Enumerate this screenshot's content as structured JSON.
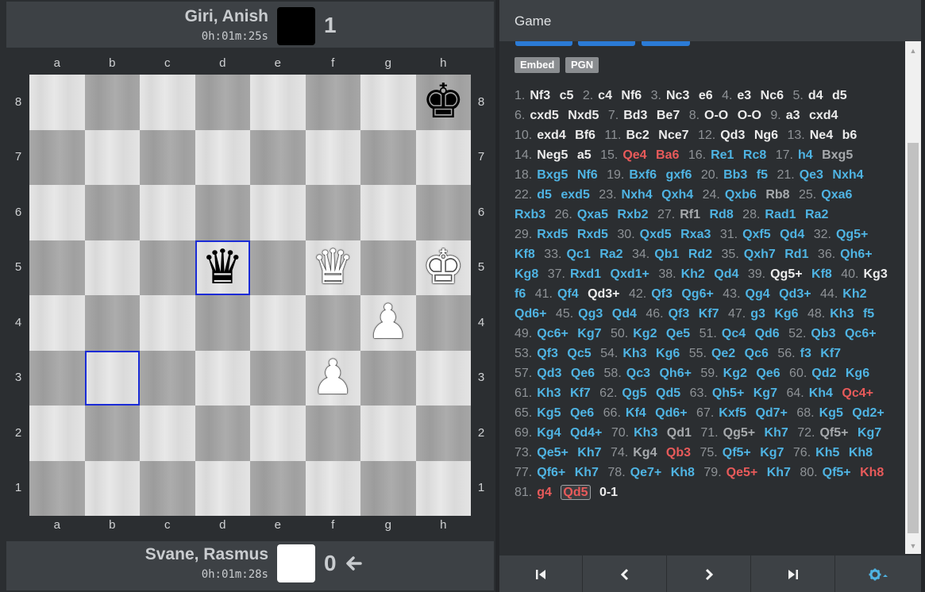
{
  "top_player": {
    "name": "Giri, Anish",
    "clock": "0h:01m:25s",
    "score": "1",
    "color": "black"
  },
  "bottom_player": {
    "name": "Svane, Rasmus",
    "clock": "0h:01m:28s",
    "score": "0",
    "color": "white",
    "to_move_icon": "arrow-left-icon"
  },
  "board": {
    "files": [
      "a",
      "b",
      "c",
      "d",
      "e",
      "f",
      "g",
      "h"
    ],
    "ranks": [
      "8",
      "7",
      "6",
      "5",
      "4",
      "3",
      "2",
      "1"
    ],
    "pieces": [
      {
        "square": "h8",
        "piece": "king",
        "color": "black"
      },
      {
        "square": "d5",
        "piece": "queen",
        "color": "black"
      },
      {
        "square": "f5",
        "piece": "queen",
        "color": "white"
      },
      {
        "square": "h5",
        "piece": "king",
        "color": "white"
      },
      {
        "square": "g4",
        "piece": "pawn",
        "color": "white"
      },
      {
        "square": "f3",
        "piece": "pawn",
        "color": "white"
      }
    ],
    "highlight_squares": [
      "d5",
      "b3"
    ],
    "highlight_color": "#1a2bd6"
  },
  "game_panel": {
    "title": "Game",
    "embed_label": "Embed",
    "pgn_label": "PGN",
    "moves": [
      {
        "n": "1.",
        "w": "Nf3",
        "wc": "white",
        "b": "c5",
        "bc": "white"
      },
      {
        "n": "2.",
        "w": "c4",
        "wc": "white",
        "b": "Nf6",
        "bc": "white"
      },
      {
        "n": "3.",
        "w": "Nc3",
        "wc": "white",
        "b": "e6",
        "bc": "white"
      },
      {
        "n": "4.",
        "w": "e3",
        "wc": "white",
        "b": "Nc6",
        "bc": "white"
      },
      {
        "n": "5.",
        "w": "d4",
        "wc": "white",
        "b": "d5",
        "bc": "white"
      },
      {
        "n": "6.",
        "w": "cxd5",
        "wc": "white",
        "b": "Nxd5",
        "bc": "white"
      },
      {
        "n": "7.",
        "w": "Bd3",
        "wc": "white",
        "b": "Be7",
        "bc": "white"
      },
      {
        "n": "8.",
        "w": "O-O",
        "wc": "white",
        "b": "O-O",
        "bc": "white"
      },
      {
        "n": "9.",
        "w": "a3",
        "wc": "white",
        "b": "cxd4",
        "bc": "white"
      },
      {
        "n": "10.",
        "w": "exd4",
        "wc": "white",
        "b": "Bf6",
        "bc": "white"
      },
      {
        "n": "11.",
        "w": "Bc2",
        "wc": "white",
        "b": "Nce7",
        "bc": "white"
      },
      {
        "n": "12.",
        "w": "Qd3",
        "wc": "white",
        "b": "Ng6",
        "bc": "white"
      },
      {
        "n": "13.",
        "w": "Ne4",
        "wc": "white",
        "b": "b6",
        "bc": "white"
      },
      {
        "n": "14.",
        "w": "Neg5",
        "wc": "white",
        "b": "a5",
        "bc": "white"
      },
      {
        "n": "15.",
        "w": "Qe4",
        "wc": "red",
        "b": "Ba6",
        "bc": "red"
      },
      {
        "n": "16.",
        "w": "Re1",
        "wc": "blue",
        "b": "Rc8",
        "bc": "blue"
      },
      {
        "n": "17.",
        "w": "h4",
        "wc": "blue",
        "b": "Bxg5",
        "bc": "grey"
      },
      {
        "n": "18.",
        "w": "Bxg5",
        "wc": "blue",
        "b": "Nf6",
        "bc": "blue"
      },
      {
        "n": "19.",
        "w": "Bxf6",
        "wc": "blue",
        "b": "gxf6",
        "bc": "blue"
      },
      {
        "n": "20.",
        "w": "Bb3",
        "wc": "blue",
        "b": "f5",
        "bc": "blue"
      },
      {
        "n": "21.",
        "w": "Qe3",
        "wc": "blue",
        "b": "Nxh4",
        "bc": "blue"
      },
      {
        "n": "22.",
        "w": "d5",
        "wc": "blue",
        "b": "exd5",
        "bc": "blue"
      },
      {
        "n": "23.",
        "w": "Nxh4",
        "wc": "blue",
        "b": "Qxh4",
        "bc": "blue"
      },
      {
        "n": "24.",
        "w": "Qxb6",
        "wc": "blue",
        "b": "Rb8",
        "bc": "grey"
      },
      {
        "n": "25.",
        "w": "Qxa6",
        "wc": "blue",
        "b": "Rxb3",
        "bc": "blue"
      },
      {
        "n": "26.",
        "w": "Qxa5",
        "wc": "blue",
        "b": "Rxb2",
        "bc": "blue"
      },
      {
        "n": "27.",
        "w": "Rf1",
        "wc": "grey",
        "b": "Rd8",
        "bc": "blue"
      },
      {
        "n": "28.",
        "w": "Rad1",
        "wc": "blue",
        "b": "Ra2",
        "bc": "blue"
      },
      {
        "n": "29.",
        "w": "Rxd5",
        "wc": "blue",
        "b": "Rxd5",
        "bc": "blue"
      },
      {
        "n": "30.",
        "w": "Qxd5",
        "wc": "blue",
        "b": "Rxa3",
        "bc": "blue"
      },
      {
        "n": "31.",
        "w": "Qxf5",
        "wc": "blue",
        "b": "Qd4",
        "bc": "blue"
      },
      {
        "n": "32.",
        "w": "Qg5+",
        "wc": "blue",
        "b": "Kf8",
        "bc": "blue"
      },
      {
        "n": "33.",
        "w": "Qc1",
        "wc": "blue",
        "b": "Ra2",
        "bc": "blue"
      },
      {
        "n": "34.",
        "w": "Qb1",
        "wc": "blue",
        "b": "Rd2",
        "bc": "blue"
      },
      {
        "n": "35.",
        "w": "Qxh7",
        "wc": "blue",
        "b": "Rd1",
        "bc": "blue"
      },
      {
        "n": "36.",
        "w": "Qh6+",
        "wc": "blue",
        "b": "Kg8",
        "bc": "blue"
      },
      {
        "n": "37.",
        "w": "Rxd1",
        "wc": "blue",
        "b": "Qxd1+",
        "bc": "blue"
      },
      {
        "n": "38.",
        "w": "Kh2",
        "wc": "blue",
        "b": "Qd4",
        "bc": "blue"
      },
      {
        "n": "39.",
        "w": "Qg5+",
        "wc": "white",
        "b": "Kf8",
        "bc": "blue"
      },
      {
        "n": "40.",
        "w": "Kg3",
        "wc": "white",
        "b": "f6",
        "bc": "blue"
      },
      {
        "n": "41.",
        "w": "Qf4",
        "wc": "blue",
        "b": "Qd3+",
        "bc": "white"
      },
      {
        "n": "42.",
        "w": "Qf3",
        "wc": "blue",
        "b": "Qg6+",
        "bc": "blue"
      },
      {
        "n": "43.",
        "w": "Qg4",
        "wc": "blue",
        "b": "Qd3+",
        "bc": "blue"
      },
      {
        "n": "44.",
        "w": "Kh2",
        "wc": "blue",
        "b": "Qd6+",
        "bc": "blue"
      },
      {
        "n": "45.",
        "w": "Qg3",
        "wc": "blue",
        "b": "Qd4",
        "bc": "blue"
      },
      {
        "n": "46.",
        "w": "Qf3",
        "wc": "blue",
        "b": "Kf7",
        "bc": "blue"
      },
      {
        "n": "47.",
        "w": "g3",
        "wc": "blue",
        "b": "Kg6",
        "bc": "blue"
      },
      {
        "n": "48.",
        "w": "Kh3",
        "wc": "blue",
        "b": "f5",
        "bc": "blue"
      },
      {
        "n": "49.",
        "w": "Qc6+",
        "wc": "blue",
        "b": "Kg7",
        "bc": "blue"
      },
      {
        "n": "50.",
        "w": "Kg2",
        "wc": "blue",
        "b": "Qe5",
        "bc": "blue"
      },
      {
        "n": "51.",
        "w": "Qc4",
        "wc": "blue",
        "b": "Qd6",
        "bc": "blue"
      },
      {
        "n": "52.",
        "w": "Qb3",
        "wc": "blue",
        "b": "Qc6+",
        "bc": "blue"
      },
      {
        "n": "53.",
        "w": "Qf3",
        "wc": "blue",
        "b": "Qc5",
        "bc": "blue"
      },
      {
        "n": "54.",
        "w": "Kh3",
        "wc": "blue",
        "b": "Kg6",
        "bc": "blue"
      },
      {
        "n": "55.",
        "w": "Qe2",
        "wc": "blue",
        "b": "Qc6",
        "bc": "blue"
      },
      {
        "n": "56.",
        "w": "f3",
        "wc": "blue",
        "b": "Kf7",
        "bc": "blue"
      },
      {
        "n": "57.",
        "w": "Qd3",
        "wc": "blue",
        "b": "Qe6",
        "bc": "blue"
      },
      {
        "n": "58.",
        "w": "Qc3",
        "wc": "blue",
        "b": "Qh6+",
        "bc": "blue"
      },
      {
        "n": "59.",
        "w": "Kg2",
        "wc": "blue",
        "b": "Qe6",
        "bc": "blue"
      },
      {
        "n": "60.",
        "w": "Qd2",
        "wc": "blue",
        "b": "Kg6",
        "bc": "blue"
      },
      {
        "n": "61.",
        "w": "Kh3",
        "wc": "blue",
        "b": "Kf7",
        "bc": "blue"
      },
      {
        "n": "62.",
        "w": "Qg5",
        "wc": "blue",
        "b": "Qd5",
        "bc": "blue"
      },
      {
        "n": "63.",
        "w": "Qh5+",
        "wc": "blue",
        "b": "Kg7",
        "bc": "blue"
      },
      {
        "n": "64.",
        "w": "Kh4",
        "wc": "blue",
        "b": "Qc4+",
        "bc": "red"
      },
      {
        "n": "65.",
        "w": "Kg5",
        "wc": "blue",
        "b": "Qe6",
        "bc": "blue"
      },
      {
        "n": "66.",
        "w": "Kf4",
        "wc": "blue",
        "b": "Qd6+",
        "bc": "blue"
      },
      {
        "n": "67.",
        "w": "Kxf5",
        "wc": "blue",
        "b": "Qd7+",
        "bc": "blue"
      },
      {
        "n": "68.",
        "w": "Kg5",
        "wc": "blue",
        "b": "Qd2+",
        "bc": "blue"
      },
      {
        "n": "69.",
        "w": "Kg4",
        "wc": "blue",
        "b": "Qd4+",
        "bc": "blue"
      },
      {
        "n": "70.",
        "w": "Kh3",
        "wc": "blue",
        "b": "Qd1",
        "bc": "grey"
      },
      {
        "n": "71.",
        "w": "Qg5+",
        "wc": "grey",
        "b": "Kh7",
        "bc": "blue"
      },
      {
        "n": "72.",
        "w": "Qf5+",
        "wc": "grey",
        "b": "Kg7",
        "bc": "blue"
      },
      {
        "n": "73.",
        "w": "Qe5+",
        "wc": "blue",
        "b": "Kh7",
        "bc": "blue"
      },
      {
        "n": "74.",
        "w": "Kg4",
        "wc": "grey",
        "b": "Qb3",
        "bc": "red"
      },
      {
        "n": "75.",
        "w": "Qf5+",
        "wc": "blue",
        "b": "Kg7",
        "bc": "blue"
      },
      {
        "n": "76.",
        "w": "Kh5",
        "wc": "blue",
        "b": "Kh8",
        "bc": "blue"
      },
      {
        "n": "77.",
        "w": "Qf6+",
        "wc": "blue",
        "b": "Kh7",
        "bc": "blue"
      },
      {
        "n": "78.",
        "w": "Qe7+",
        "wc": "blue",
        "b": "Kh8",
        "bc": "blue"
      },
      {
        "n": "79.",
        "w": "Qe5+",
        "wc": "red",
        "b": "Kh7",
        "bc": "blue"
      },
      {
        "n": "80.",
        "w": "Qf5+",
        "wc": "blue",
        "b": "Kh8",
        "bc": "red"
      },
      {
        "n": "81.",
        "w": "g4",
        "wc": "red",
        "b": "Qd5",
        "bc": "current"
      }
    ],
    "result": "0-1"
  },
  "nav": {
    "first_icon": "skip-to-start-icon",
    "prev_icon": "chevron-left-icon",
    "next_icon": "chevron-right-icon",
    "last_icon": "skip-to-end-icon",
    "settings_icon": "gear-icon"
  },
  "colors": {
    "blue_move": "#4fb4e3",
    "red_move": "#e85a5a",
    "grey_move": "#a6a9ac",
    "panel_bg": "#2b2e31",
    "bar_bg": "#3d4145"
  }
}
